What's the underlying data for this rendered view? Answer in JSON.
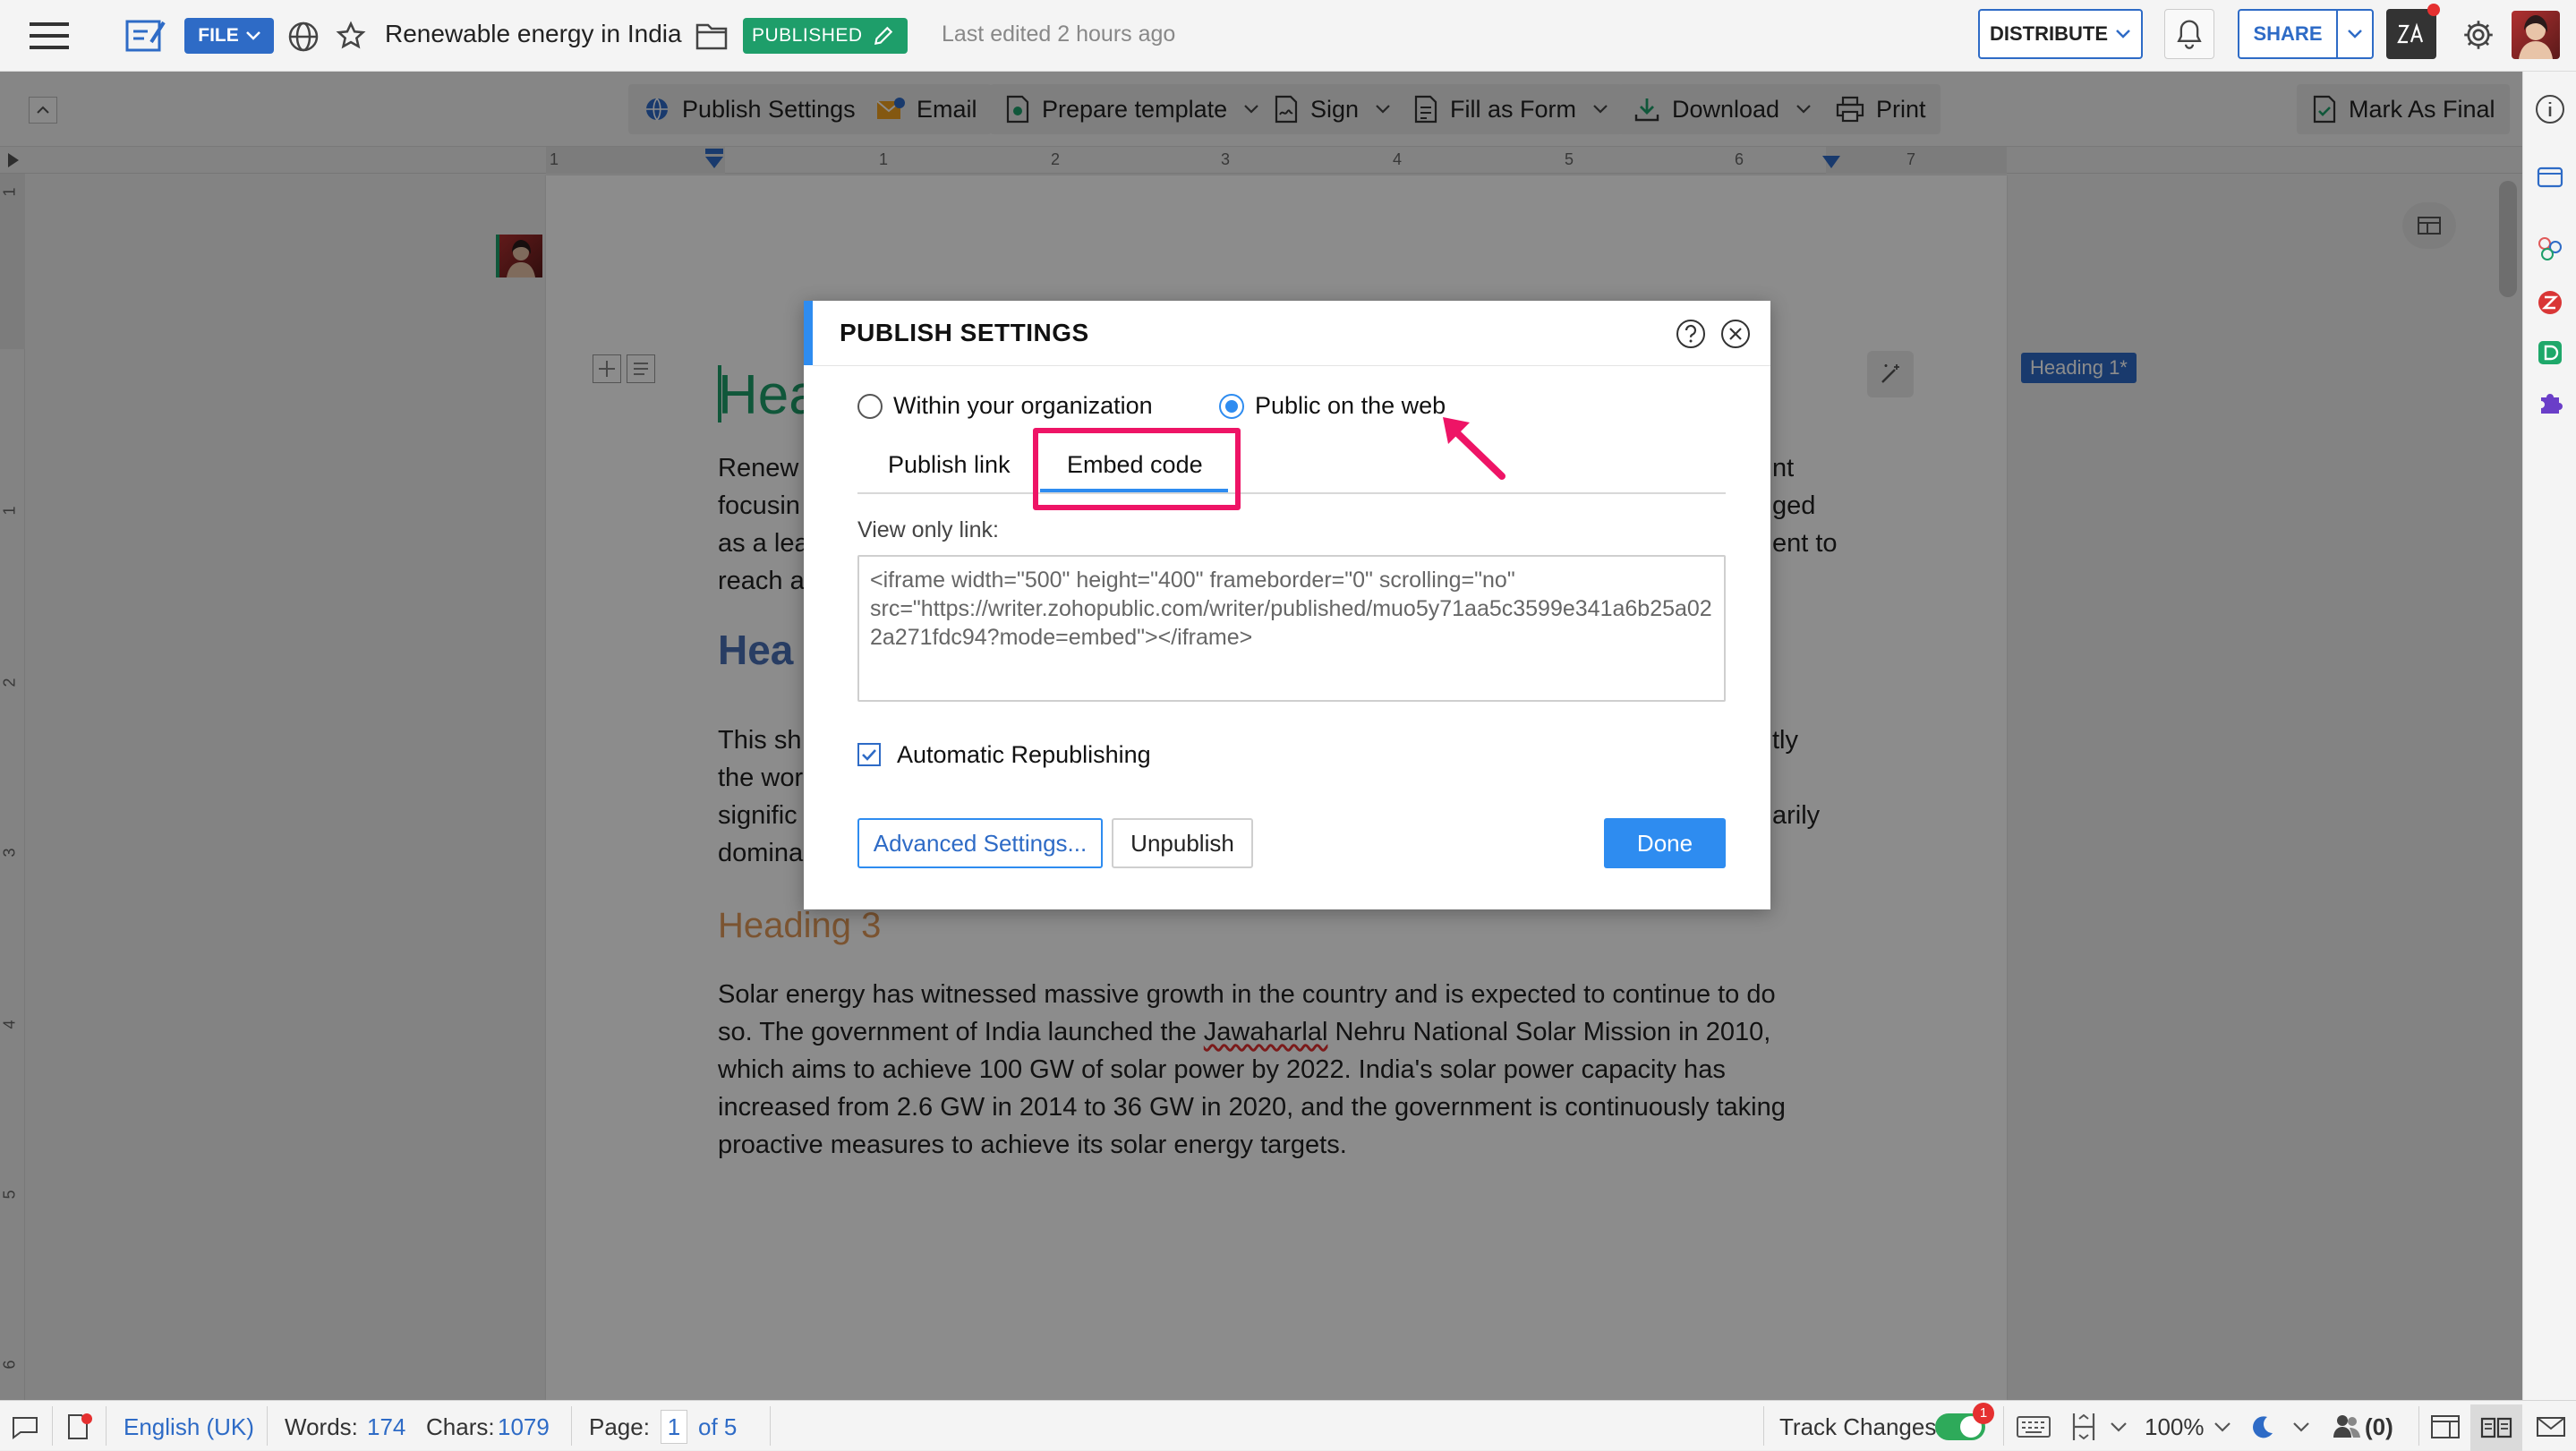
{
  "topbar": {
    "file_label": "FILE",
    "doc_title": "Renewable energy in India",
    "status_badge": "PUBLISHED",
    "last_edited": "Last edited 2 hours ago",
    "distribute_label": "DISTRIBUTE",
    "share_label": "SHARE"
  },
  "toolbar": {
    "publish_settings": "Publish Settings",
    "email": "Email",
    "prepare_template": "Prepare template",
    "sign": "Sign",
    "fill_as_form": "Fill as Form",
    "download": "Download",
    "print": "Print",
    "mark_as_final": "Mark As Final"
  },
  "ruler": {
    "numbers": [
      "1",
      "1",
      "2",
      "3",
      "4",
      "5",
      "6",
      "7"
    ]
  },
  "vruler": {
    "numbers": [
      "1",
      "1",
      "2",
      "3",
      "4",
      "5",
      "6"
    ]
  },
  "document": {
    "heading1_partial": "Hea",
    "heading2_partial": "Hea",
    "heading3": "Heading 3",
    "style_badge": "Heading 1*",
    "para1": [
      "Renew",
      "focusin",
      "as a lea",
      "reach a"
    ],
    "para1_right": [
      "nt",
      "ged",
      "ent to"
    ],
    "para2": [
      "This sh",
      "the wor",
      "signific",
      "domina"
    ],
    "para2_right": [
      "tly",
      "arily"
    ],
    "solar_lines": [
      "Solar energy has witnessed massive growth in the country and is expected to continue to do",
      "so. The government of India launched the ",
      "which aims to achieve 100 GW of solar power by 2022. India's solar power capacity has",
      "increased from 2.6 GW in 2014 to 36 GW in 2020, and the government is continuously taking",
      "proactive measures to achieve its solar energy targets."
    ],
    "solar_line2_misspelled": "Jawaharlal",
    "solar_line2_rest": " Nehru National Solar Mission in 2010,"
  },
  "dialog": {
    "title": "PUBLISH SETTINGS",
    "option_org": "Within your organization",
    "option_web": "Public on the web",
    "tab_publish_link": "Publish link",
    "tab_embed_code": "Embed code",
    "view_only_label": "View only link:",
    "embed_code": "<iframe width=\"500\" height=\"400\" frameborder=\"0\" scrolling=\"no\" src=\"https://writer.zohopublic.com/writer/published/muo5y71aa5c3599e341a6b25a022a271fdc94?mode=embed\"></iframe>",
    "auto_republish": "Automatic Republishing",
    "advanced_settings": "Advanced Settings...",
    "unpublish": "Unpublish",
    "done": "Done"
  },
  "statusbar": {
    "language": "English (UK)",
    "words_label": "Words:",
    "words_value": "174",
    "chars_label": "Chars:",
    "chars_value": "1079",
    "page_label": "Page:",
    "page_current": "1",
    "page_total": "of 5",
    "track_changes": "Track Changes",
    "track_badge": "1",
    "zoom": "100%",
    "collab_count": "(0)"
  },
  "colors": {
    "accent_blue": "#2e6bc6",
    "published_green": "#1e9e6a",
    "highlight_pink": "#ee1466",
    "heading3_orange": "#e09a5a",
    "heading_blue": "#4a6fb5"
  }
}
